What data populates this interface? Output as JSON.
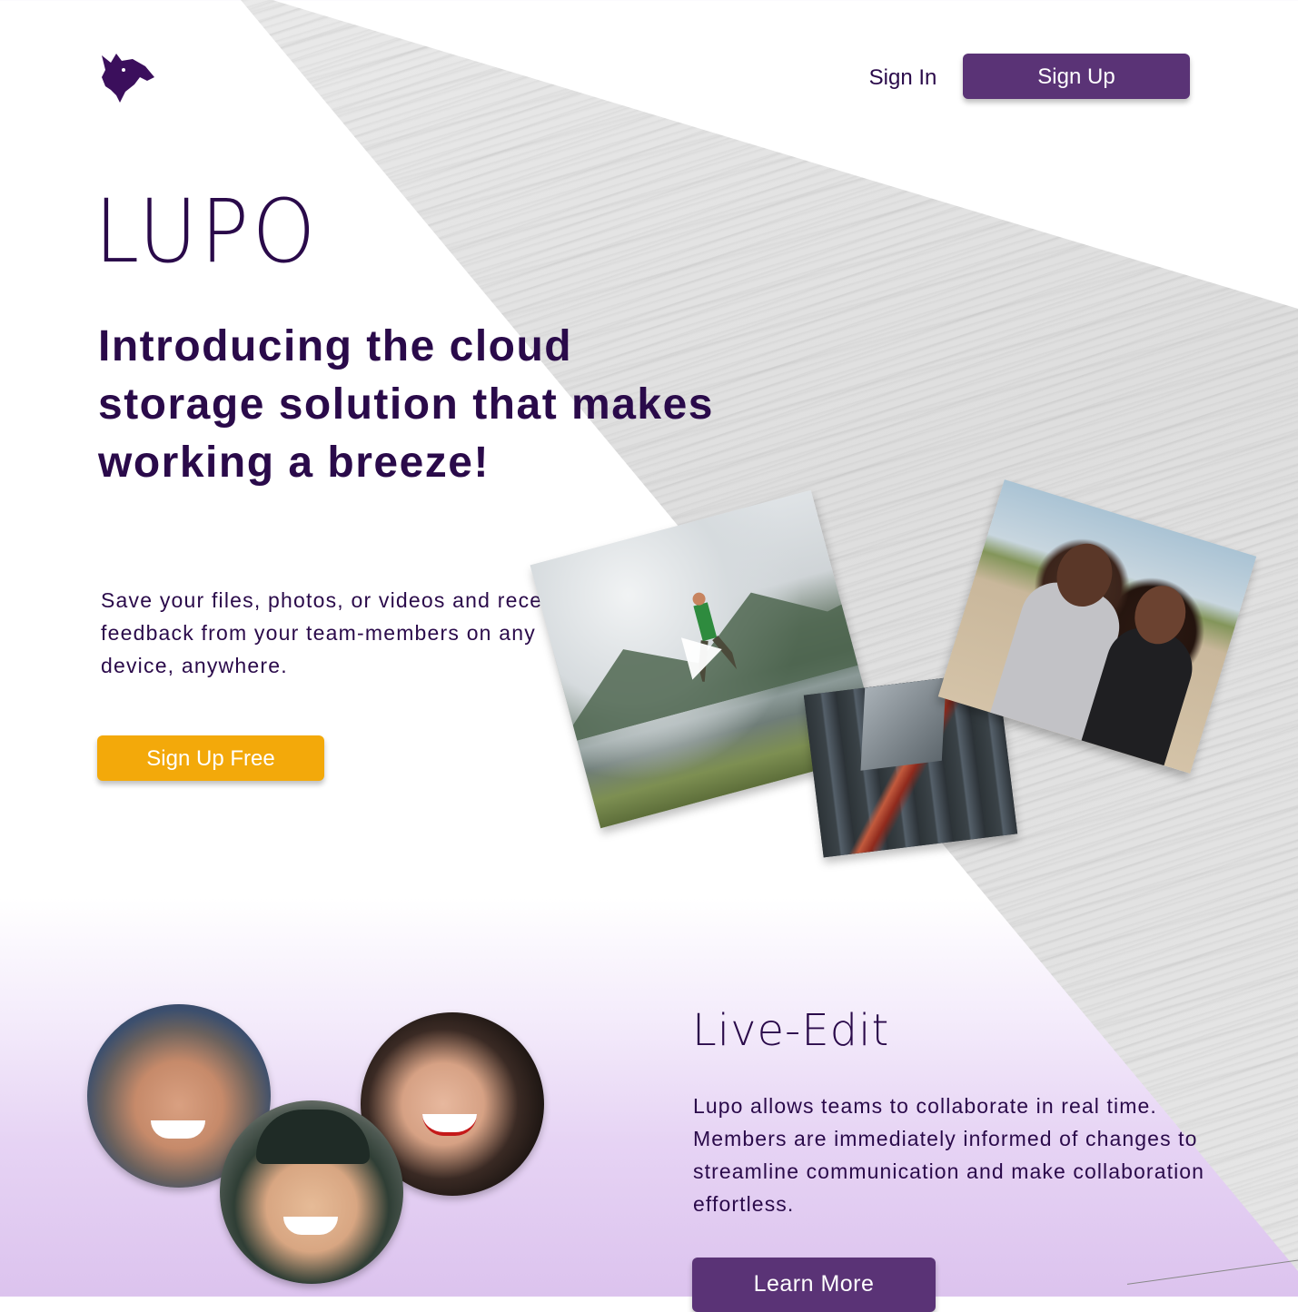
{
  "header": {
    "logo_icon": "wolf-head-logo",
    "signin_label": "Sign In",
    "signup_label": "Sign Up"
  },
  "hero": {
    "brand": "LUPO",
    "headline": "Introducing the cloud storage solution that makes working a breeze!",
    "subtext": "Save your files, photos, or videos and receive feedback from your team-members on any device, anywhere.",
    "cta_label": "Sign Up Free"
  },
  "gallery": {
    "items": [
      {
        "name": "video-jumper-lake",
        "has_play_icon": true
      },
      {
        "name": "photo-city-aerial"
      },
      {
        "name": "photo-two-women-beach"
      }
    ]
  },
  "feature": {
    "title": "Live-Edit",
    "text": "Lupo allows teams to collaborate in real time. Members are immediately informed of changes to streamline communication and make collaboration effortless.",
    "cta_label": "Learn More"
  },
  "colors": {
    "primary": "#5a3376",
    "accent": "#f3a90a",
    "text": "#2a0a4a"
  }
}
